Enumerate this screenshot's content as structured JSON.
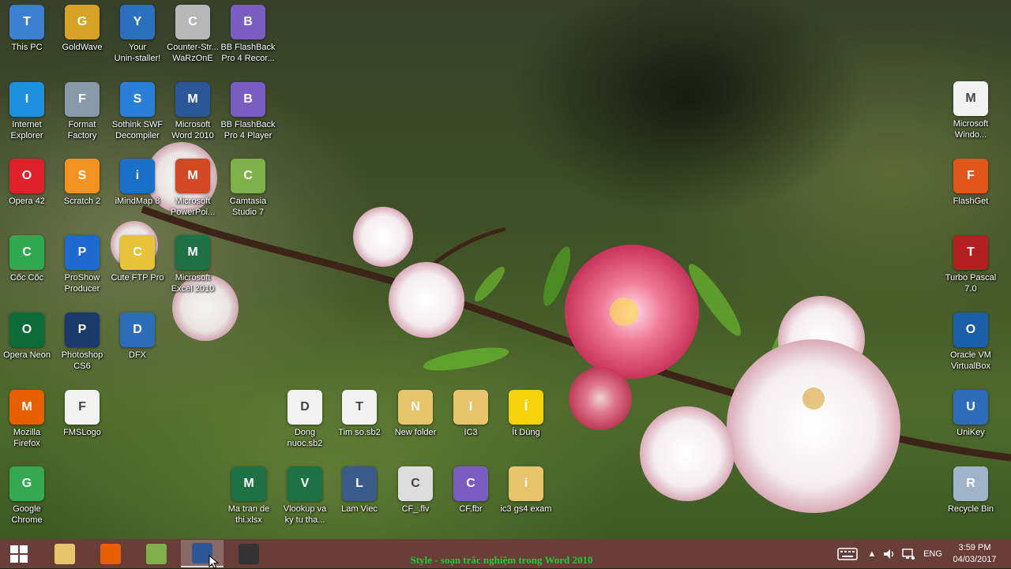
{
  "desktop": {
    "icons_left": [
      {
        "label": "This PC",
        "icon": "computer-icon",
        "color": "#3c7fd0"
      },
      {
        "label": "GoldWave",
        "icon": "goldwave-icon",
        "color": "#d6a326"
      },
      {
        "label": "Your\nUnin-staller!",
        "icon": "uninstaller-icon",
        "color": "#2d6fbf"
      },
      {
        "label": "Counter-Str...\nWaRzOnE",
        "icon": "counter-strike-icon",
        "color": "#b7b7b7"
      },
      {
        "label": "BB FlashBack\nPro 4 Recor...",
        "icon": "flashback-recorder-icon",
        "color": "#7a5dc0"
      },
      {
        "label": "Internet\nExplorer",
        "icon": "internet-explorer-icon",
        "color": "#1f8fe0"
      },
      {
        "label": "Format\nFactory",
        "icon": "format-factory-icon",
        "color": "#8899aa"
      },
      {
        "label": "Sothink SWF\nDecompiler",
        "icon": "sothink-icon",
        "color": "#2b7fd8"
      },
      {
        "label": "Microsoft\nWord 2010",
        "icon": "word-icon",
        "color": "#2b5797"
      },
      {
        "label": "BB FlashBack\nPro 4 Player",
        "icon": "flashback-player-icon",
        "color": "#7a5dc0"
      },
      {
        "label": "Opera 42",
        "icon": "opera-icon",
        "color": "#e0202b"
      },
      {
        "label": "Scratch 2",
        "icon": "scratch-icon",
        "color": "#f29221"
      },
      {
        "label": "iMindMap 8",
        "icon": "imindmap-icon",
        "color": "#1a6fc8"
      },
      {
        "label": "Microsoft\nPowerPoi...",
        "icon": "powerpoint-icon",
        "color": "#d24726"
      },
      {
        "label": "Camtasia\nStudio 7",
        "icon": "camtasia-icon",
        "color": "#7fb14b"
      },
      {
        "label": "Cốc Cốc",
        "icon": "coccoc-icon",
        "color": "#2fa84f"
      },
      {
        "label": "ProShow\nProducer",
        "icon": "proshow-icon",
        "color": "#1f6ad0"
      },
      {
        "label": "Cute FTP Pro",
        "icon": "cuteftp-icon",
        "color": "#e8c23a"
      },
      {
        "label": "Microsoft\nExcel 2010",
        "icon": "excel-icon",
        "color": "#1e7145"
      },
      {
        "label": "Opera Neon",
        "icon": "opera-neon-icon",
        "color": "#0d6b3a"
      },
      {
        "label": "Photoshop\nCS6",
        "icon": "photoshop-icon",
        "color": "#1b3a6b"
      },
      {
        "label": "DFX",
        "icon": "dfx-icon",
        "color": "#2d6db7"
      },
      {
        "label": "Mozilla\nFirefox",
        "icon": "firefox-icon",
        "color": "#e66000"
      },
      {
        "label": "FMSLogo",
        "icon": "fmslogo-icon",
        "color": "#f2f2f2"
      },
      {
        "label": "Google\nChrome",
        "icon": "chrome-icon",
        "color": "#34a853"
      }
    ],
    "icons_bottom": [
      {
        "label": "Dong\nnuoc.sb2",
        "icon": "scratch-file-icon",
        "color": "#f2f2f2"
      },
      {
        "label": "Tim so.sb2",
        "icon": "scratch-file-icon",
        "color": "#f2f2f2"
      },
      {
        "label": "New folder",
        "icon": "folder-icon",
        "color": "#e8c46a"
      },
      {
        "label": "IC3",
        "icon": "folder-icon",
        "color": "#e8c46a"
      },
      {
        "label": "Ít Dùng",
        "icon": "smiley-icon",
        "color": "#f4d20c"
      },
      {
        "label": "Ma tran de\nthi.xlsx",
        "icon": "excel-file-icon",
        "color": "#1e7145"
      },
      {
        "label": "Vlookup va\nky tu tha...",
        "icon": "excel-file-icon",
        "color": "#1e7145"
      },
      {
        "label": "Lam Viec",
        "icon": "lam-viec-icon",
        "color": "#3a5a8a"
      },
      {
        "label": "CF_.flv",
        "icon": "flv-file-icon",
        "color": "#dddddd"
      },
      {
        "label": "CF.fbr",
        "icon": "fbr-file-icon",
        "color": "#7a5dc0"
      },
      {
        "label": "ic3 gs4 exam",
        "icon": "folder-icon",
        "color": "#e8c46a"
      }
    ],
    "icons_right": [
      {
        "label": "Microsoft\nWindo...",
        "icon": "windows-logo-file-icon",
        "color": "#f2f2f2"
      },
      {
        "label": "FlashGet",
        "icon": "flashget-icon",
        "color": "#e0561b"
      },
      {
        "label": "Turbo Pascal\n7.0",
        "icon": "turbo-pascal-icon",
        "color": "#b2201f"
      },
      {
        "label": "Oracle VM\nVirtualBox",
        "icon": "virtualbox-icon",
        "color": "#1a5fa8"
      },
      {
        "label": "UniKey",
        "icon": "unikey-icon",
        "color": "#2d6db7"
      },
      {
        "label": "Recycle Bin",
        "icon": "recycle-bin-icon",
        "color": "#9fb4c8"
      }
    ]
  },
  "taskbar": {
    "start_icon": "windows-start-icon",
    "pinned": [
      {
        "icon": "file-explorer-icon",
        "color": "#e8c46a"
      },
      {
        "icon": "firefox-icon",
        "color": "#e66000"
      },
      {
        "icon": "camtasia-icon",
        "color": "#7fb14b"
      },
      {
        "icon": "word-icon",
        "color": "#2b5797"
      },
      {
        "icon": "camera-recorder-icon",
        "color": "#333333"
      }
    ],
    "tray": {
      "keyboard_icon": "keyboard-icon",
      "expand_icon": "chevron-up-icon",
      "volume_icon": "volume-icon",
      "network_icon": "network-icon",
      "language": "ENG"
    },
    "clock": {
      "time": "3:59 PM",
      "date": "04/03/2017"
    }
  },
  "overlay_caption": "Style - soạn trắc nghiệm trong Word 2010"
}
